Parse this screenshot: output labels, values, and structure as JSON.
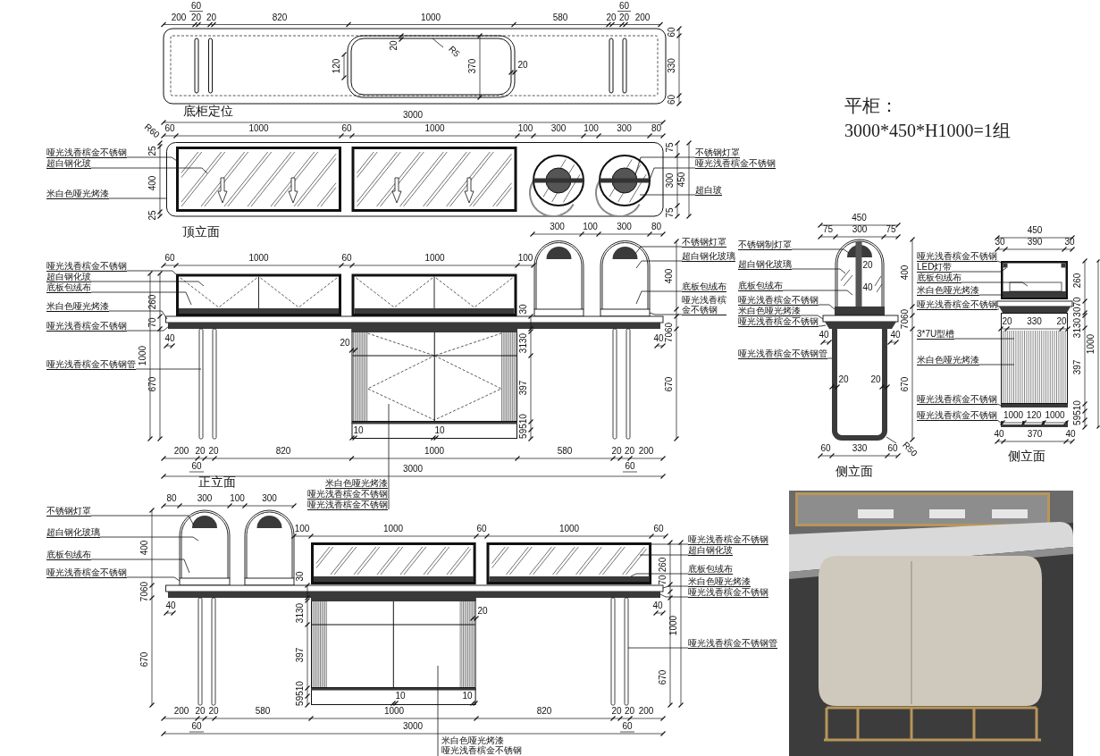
{
  "spec": {
    "title": "平柜：",
    "size": "3000*450*H1000=1组"
  },
  "views": [
    {
      "kind": "plan",
      "title": "底柜定位",
      "dimension_chains": [
        [
          "200",
          "20",
          "20",
          "820",
          "1000",
          "580",
          "20",
          "20",
          "200"
        ],
        [
          "60"
        ],
        [
          "60"
        ],
        [
          "60",
          "330",
          "60"
        ],
        [
          "20"
        ],
        [
          "R5"
        ],
        [
          "120"
        ],
        [
          "370"
        ],
        [
          "20"
        ]
      ]
    },
    {
      "kind": "top_elevation",
      "title": "顶立面",
      "dimension_chains": [
        [
          "3000"
        ],
        [
          "60",
          "1000",
          "60",
          "1000",
          "100",
          "300",
          "100",
          "300",
          "80"
        ],
        [
          "R60"
        ],
        [
          "25",
          "400",
          "25"
        ],
        [
          "75",
          "300",
          "75"
        ],
        [
          "450"
        ]
      ],
      "notes": {
        "left": [
          "哑光浅香槟金不锈钢",
          "超白钢化玻",
          "米白色哑光烤漆"
        ],
        "right": [
          "不锈钢灯罩",
          "哑光浅香槟金不锈钢",
          "超白玻"
        ]
      }
    },
    {
      "kind": "front_elevation",
      "title": "正立面",
      "dimension_chains": [
        [
          "300",
          "100",
          "300",
          "80"
        ],
        [
          "60",
          "1000",
          "60",
          "1000",
          "100"
        ],
        [
          "1000"
        ],
        [
          "260",
          "70",
          "670"
        ],
        [
          "400",
          "7060",
          "670"
        ],
        [
          "30",
          "3130",
          "397",
          "59510"
        ],
        [
          "40"
        ],
        [
          "40"
        ],
        [
          "20"
        ],
        [
          "10"
        ],
        [
          "10"
        ],
        [
          "200",
          "20",
          "20",
          "820",
          "1000",
          "580",
          "20",
          "20",
          "200"
        ],
        [
          "60"
        ],
        [
          "3000"
        ],
        [
          "60"
        ]
      ],
      "notes": {
        "left": [
          "哑光浅香槟金不锈钢",
          "超白钢化玻",
          "底板包绒布",
          "米白色哑光烤漆",
          "哑光浅香槟金不锈钢",
          "哑光浅香槟金不锈钢管"
        ],
        "right": [
          "不锈钢灯罩",
          "超白钢化玻璃",
          "底板包绒布",
          "哑光浅香槟金不锈钢"
        ],
        "bottom": [
          "米白色哑光烤漆",
          "哑光浅香槟金不锈钢",
          "哑光浅香槟金不锈钢"
        ]
      }
    },
    {
      "kind": "side_lamp",
      "title": "侧立面",
      "dimension_chains": [
        [
          "450"
        ],
        [
          "75",
          "300",
          "75"
        ],
        [
          "400",
          "7060",
          "670"
        ],
        [
          "40"
        ],
        [
          "40"
        ],
        [
          "20"
        ],
        [
          "40"
        ],
        [
          "20"
        ],
        [
          "20"
        ],
        [
          "60",
          "330",
          "60"
        ],
        [
          "R50"
        ]
      ],
      "notes": {
        "left": [
          "不锈钢制灯罩",
          "超白钢化玻璃",
          "底板包绒布",
          "哑光浅香槟金不锈钢",
          "米白色哑光烤漆",
          "哑光浅香槟金不锈钢",
          "哑光浅香槟金不锈钢管"
        ]
      }
    },
    {
      "kind": "side_cabinet",
      "title": "侧立面",
      "dimension_chains": [
        [
          "450"
        ],
        [
          "30",
          "390",
          "30"
        ],
        [
          "260",
          "3070",
          "3130",
          "397",
          "59510"
        ],
        [
          "1000"
        ],
        [
          "20",
          "330",
          "20"
        ],
        [
          "1000",
          "120",
          "1000"
        ],
        [
          "40",
          "370",
          "40"
        ]
      ],
      "notes": {
        "left": [
          "哑光浅香槟金不锈钢",
          "LED灯带",
          "底板包绒布",
          "米白色哑光烤漆",
          "哑光浅香槟金不锈钢",
          "3*7U型槽",
          "米白色哑光烤漆",
          "哑光浅香槟金不锈钢",
          "哑光浅香槟金不锈钢"
        ]
      }
    },
    {
      "kind": "back_elevation",
      "dimension_chains": [
        [
          "80",
          "300",
          "100",
          "300"
        ],
        [
          "100",
          "1000",
          "60",
          "1000",
          "60"
        ],
        [
          "400",
          "7060",
          "670"
        ],
        [
          "30",
          "3130",
          "397",
          "59510"
        ],
        [
          "260",
          "70",
          "670"
        ],
        [
          "1000"
        ],
        [
          "40"
        ],
        [
          "40"
        ],
        [
          "20"
        ],
        [
          "10"
        ],
        [
          "10"
        ],
        [
          "200",
          "20",
          "20",
          "580",
          "1000",
          "820",
          "20",
          "20",
          "200"
        ],
        [
          "60"
        ],
        [
          "3000"
        ],
        [
          "60"
        ]
      ],
      "notes": {
        "left": [
          "不锈钢灯罩",
          "超白钢化玻璃",
          "底板包绒布",
          "哑光浅香槟金不锈钢"
        ],
        "right": [
          "哑光浅香槟金不锈钢",
          "超白钢化玻",
          "底板包绒布",
          "米白色哑光烤漆",
          "哑光浅香槟金不锈钢",
          "哑光浅香槟金不锈钢管"
        ],
        "bottom": [
          "米白色哑光烤漆",
          "哑光浅香槟金不锈钢"
        ]
      }
    },
    {
      "kind": "render"
    }
  ]
}
